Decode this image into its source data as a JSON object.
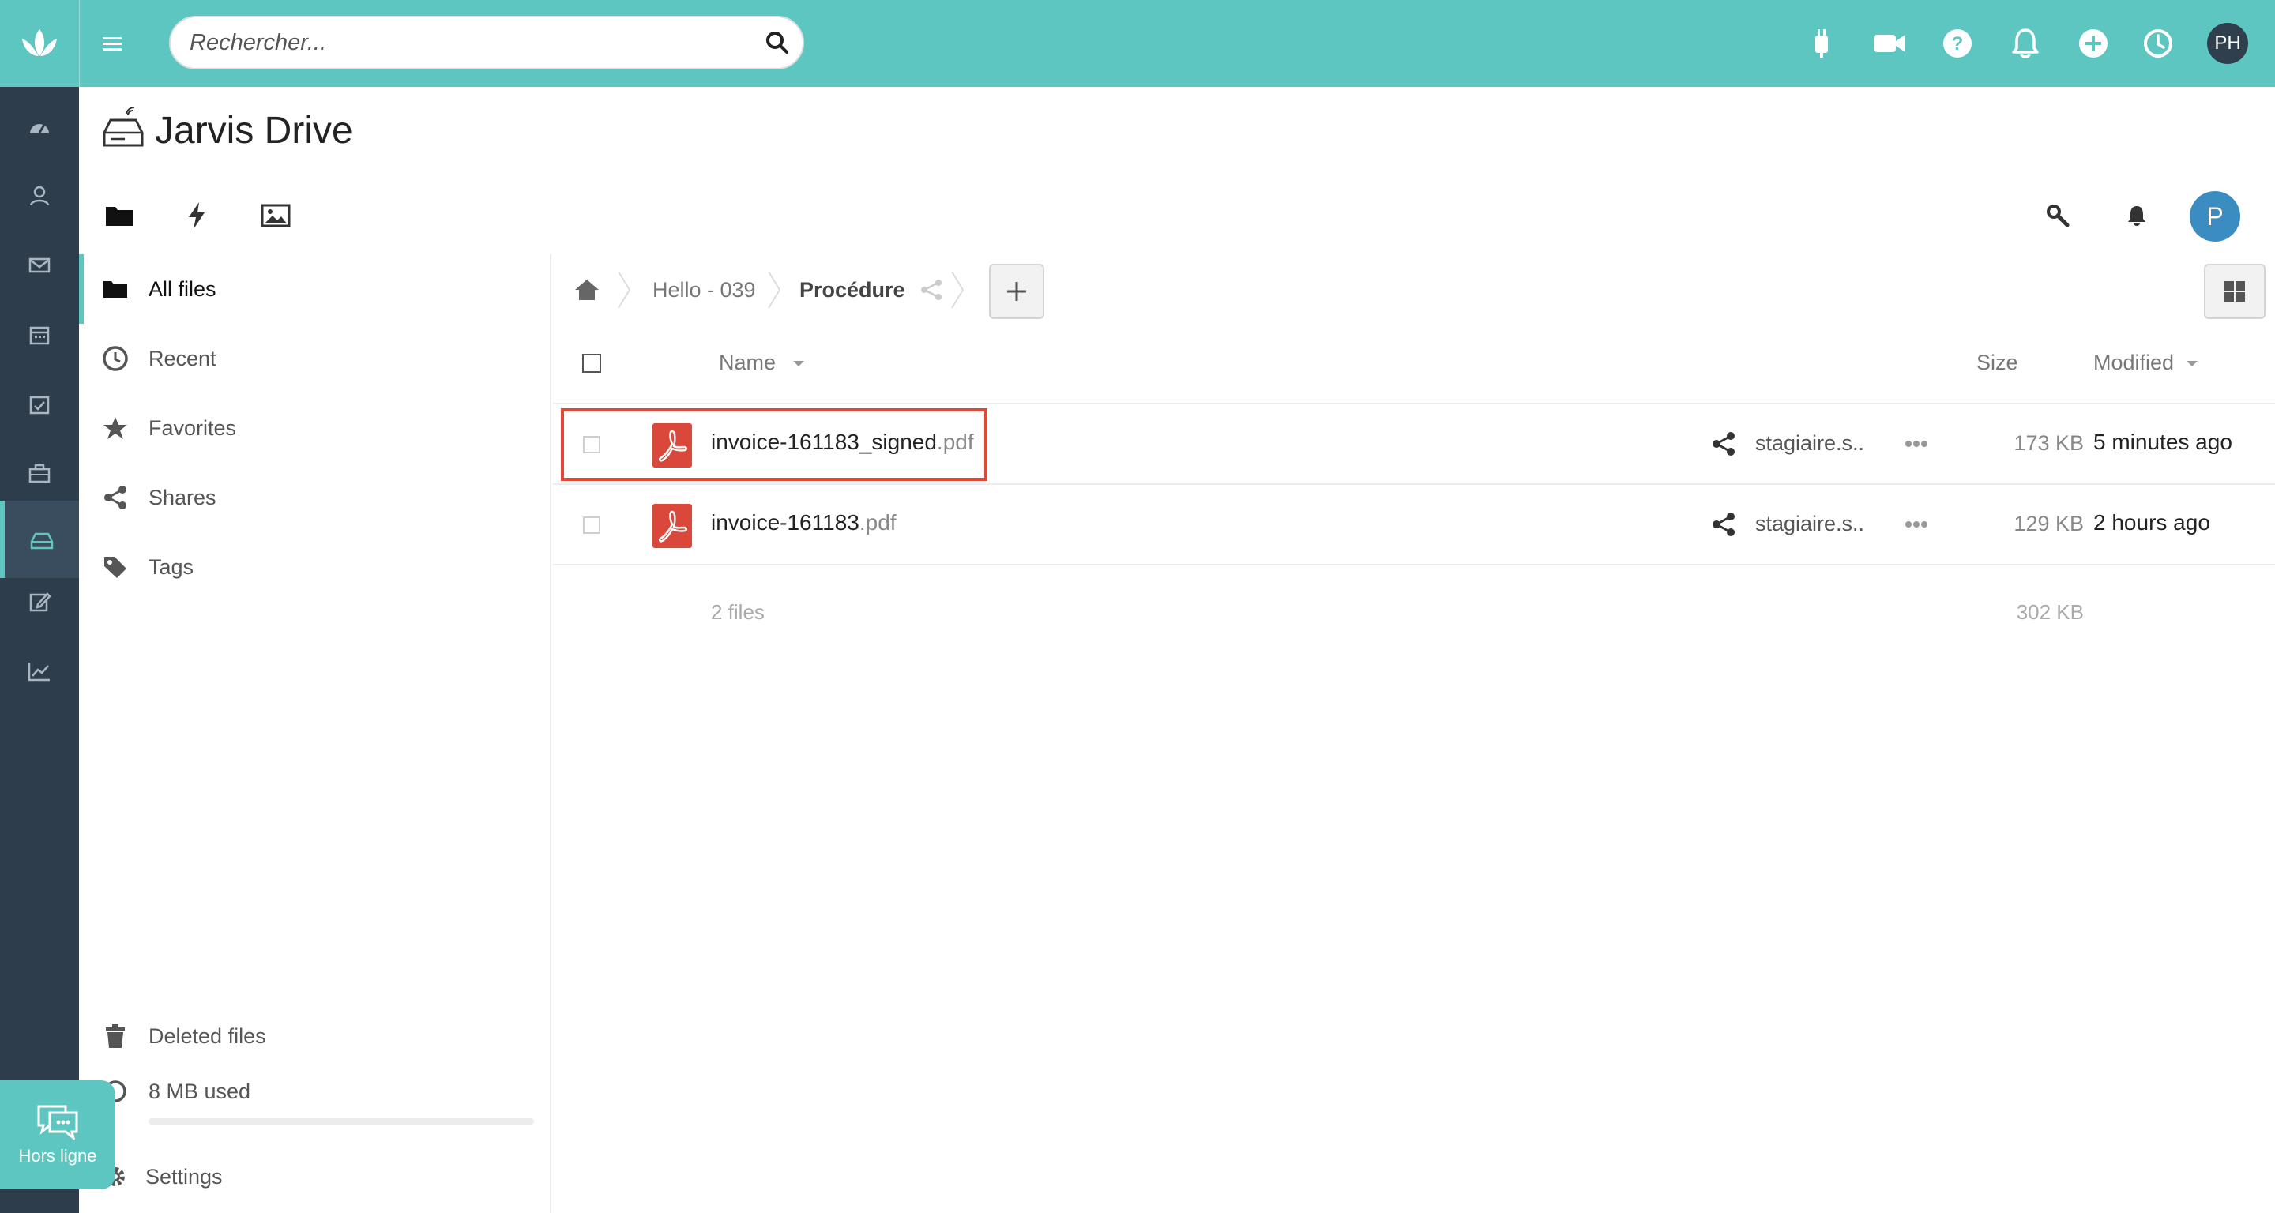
{
  "topbar": {
    "search_placeholder": "Rechercher...",
    "icons": [
      "plugin-icon",
      "video-icon",
      "help-icon",
      "bell-icon",
      "add-circle-icon",
      "clock-icon"
    ],
    "avatar_initials": "PH",
    "bar_color": "#5ec6c0"
  },
  "rail": {
    "items": [
      "dashboard-icon",
      "contacts-icon",
      "mail-icon",
      "calendar-icon",
      "tasks-icon",
      "briefcase-icon",
      "drive-icon",
      "notes-icon",
      "analytics-icon"
    ],
    "active": "drive-icon",
    "color": "#2e3d4b"
  },
  "app": {
    "title": "Jarvis Drive",
    "view_tabs": [
      "folder-icon",
      "lightning-icon",
      "image-icon"
    ],
    "user_initial": "P"
  },
  "sidebar": {
    "items": [
      {
        "label": "All files",
        "icon": "folder-icon",
        "active": true
      },
      {
        "label": "Recent",
        "icon": "clock-icon"
      },
      {
        "label": "Favorites",
        "icon": "star-icon"
      },
      {
        "label": "Shares",
        "icon": "share-icon"
      },
      {
        "label": "Tags",
        "icon": "tag-icon"
      }
    ],
    "deleted_label": "Deleted files",
    "quota_label": "8 MB used",
    "quota_fraction": 0.0,
    "settings_label": "Settings"
  },
  "chat": {
    "label": "Hors ligne"
  },
  "breadcrumb": {
    "items": [
      "Hello - 039",
      "Procédure"
    ]
  },
  "table": {
    "columns": {
      "name": "Name",
      "size": "Size",
      "modified": "Modified"
    },
    "rows": [
      {
        "name": "invoice-161183_signed",
        "ext": ".pdf",
        "owner": "stagiaire.s..",
        "size": "173 KB",
        "modified": "5 minutes ago",
        "highlighted": true
      },
      {
        "name": "invoice-161183",
        "ext": ".pdf",
        "owner": "stagiaire.s..",
        "size": "129 KB",
        "modified": "2 hours ago",
        "highlighted": false
      }
    ],
    "summary_count": "2 files",
    "summary_size": "302 KB"
  },
  "colors": {
    "accent": "#5ec6c0",
    "highlight": "#e0483a",
    "pdf": "#d9483b"
  }
}
